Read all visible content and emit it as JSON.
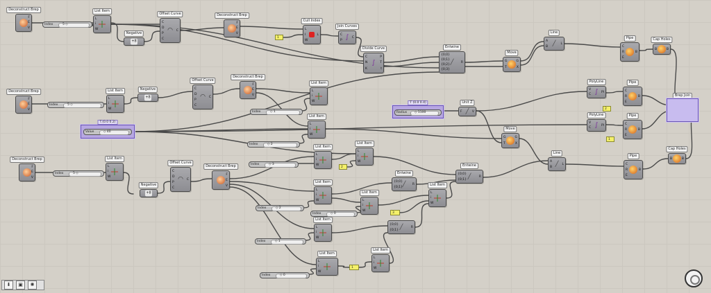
{
  "nodes": [
    {
      "id": "db1",
      "label": "Deconstruct Brep",
      "ins": [
        ""
      ],
      "outs": [
        "F",
        "E",
        "V"
      ],
      "icon": "brep"
    },
    {
      "id": "li1",
      "label": "List Item",
      "ins": [
        "L",
        "i",
        "W"
      ],
      "outs": [],
      "icon": "item"
    },
    {
      "id": "neg1",
      "label": "Negative",
      "ins": [],
      "outs": [],
      "icon": "neg"
    },
    {
      "id": "oc1",
      "label": "Offset Curve",
      "ins": [
        "C",
        "D",
        "P",
        "C"
      ],
      "outs": [
        "C"
      ],
      "icon": "offset"
    },
    {
      "id": "db2",
      "label": "Deconstruct Brep",
      "ins": [
        ""
      ],
      "outs": [
        "F",
        "E",
        "V"
      ],
      "icon": "brep"
    },
    {
      "id": "ci",
      "label": "Cull Index",
      "ins": [
        "L",
        "I",
        "W"
      ],
      "outs": [
        "L"
      ],
      "icon": "cull"
    },
    {
      "id": "jc",
      "label": "Join Curves",
      "ins": [
        "C",
        "P"
      ],
      "outs": [
        "C"
      ],
      "icon": "curve"
    },
    {
      "id": "dc",
      "label": "Divide Curve",
      "ins": [
        "C",
        "N",
        "K"
      ],
      "outs": [
        "P",
        "T",
        "t"
      ],
      "icon": "curve"
    },
    {
      "id": "ent1",
      "label": "Entwine",
      "ins": [
        "{0;0}",
        "{0;1}",
        "{0;2}",
        "{0;3}"
      ],
      "outs": [
        "R"
      ],
      "icon": "line"
    },
    {
      "id": "mv1",
      "label": "Move",
      "ins": [
        "G",
        "T"
      ],
      "outs": [
        "G",
        "X"
      ],
      "icon": "move"
    },
    {
      "id": "ln1",
      "label": "Line",
      "ins": [
        "A",
        "B"
      ],
      "outs": [
        "L"
      ],
      "icon": "line"
    },
    {
      "id": "pp1",
      "label": "Pipe",
      "ins": [
        "C",
        "R",
        "E"
      ],
      "outs": [
        "B"
      ],
      "icon": "pipe"
    },
    {
      "id": "ch1",
      "label": "Cap Holes",
      "ins": [
        "B"
      ],
      "outs": [
        "B"
      ],
      "icon": "pipe"
    },
    {
      "id": "db3",
      "label": "Deconstruct Brep",
      "ins": [
        ""
      ],
      "outs": [
        "F",
        "E",
        "V"
      ],
      "icon": "brep"
    },
    {
      "id": "li2",
      "label": "List Item",
      "ins": [
        "L",
        "i",
        "W"
      ],
      "outs": [],
      "icon": "item"
    },
    {
      "id": "neg2",
      "label": "Negative",
      "ins": [],
      "outs": [],
      "icon": "neg"
    },
    {
      "id": "oc2",
      "label": "Offset Curve",
      "ins": [
        "C",
        "D",
        "P",
        "C"
      ],
      "outs": [
        "C"
      ],
      "icon": "offset"
    },
    {
      "id": "db4",
      "label": "Deconstruct Brep",
      "ins": [
        ""
      ],
      "outs": [
        "F",
        "E",
        "V"
      ],
      "icon": "brep"
    },
    {
      "id": "li3",
      "label": "List Item",
      "ins": [
        "L",
        "i",
        "W"
      ],
      "outs": [],
      "icon": "item"
    },
    {
      "id": "li4",
      "label": "List Item",
      "ins": [
        "L",
        "i",
        "W"
      ],
      "outs": [],
      "icon": "item"
    },
    {
      "id": "pl1",
      "label": "PolyLine",
      "ins": [
        "V",
        "C"
      ],
      "outs": [
        "Pl"
      ],
      "icon": "curve"
    },
    {
      "id": "pp2",
      "label": "Pipe",
      "ins": [
        "C",
        "R",
        "E"
      ],
      "outs": [
        "B"
      ],
      "icon": "pipe"
    },
    {
      "id": "unz",
      "label": "Unit Z",
      "ins": [
        "F"
      ],
      "outs": [
        "V"
      ],
      "icon": "line"
    },
    {
      "id": "bj",
      "label": "Brep Join",
      "ins": [
        "B"
      ],
      "outs": [
        "B",
        "C"
      ],
      "icon": "brep"
    },
    {
      "id": "pl2",
      "label": "PolyLine",
      "ins": [
        "V",
        "C"
      ],
      "outs": [
        "Pl"
      ],
      "icon": "curve"
    },
    {
      "id": "pp3",
      "label": "Pipe",
      "ins": [
        "C",
        "R",
        "E"
      ],
      "outs": [
        "B"
      ],
      "icon": "pipe"
    },
    {
      "id": "mv2",
      "label": "Move",
      "ins": [
        "G",
        "T"
      ],
      "outs": [
        "G",
        "X"
      ],
      "icon": "move"
    },
    {
      "id": "db5",
      "label": "Deconstruct Brep",
      "ins": [
        ""
      ],
      "outs": [
        "F",
        "E",
        "V"
      ],
      "icon": "brep"
    },
    {
      "id": "li5",
      "label": "List Item",
      "ins": [
        "L",
        "i",
        "W"
      ],
      "outs": [],
      "icon": "item"
    },
    {
      "id": "oc3",
      "label": "Offset Curve",
      "ins": [
        "C",
        "D",
        "P",
        "C"
      ],
      "outs": [
        "C"
      ],
      "icon": "offset"
    },
    {
      "id": "db6",
      "label": "Deconstruct Brep",
      "ins": [
        ""
      ],
      "outs": [
        "F",
        "E",
        "V"
      ],
      "icon": "brep"
    },
    {
      "id": "neg3",
      "label": "Negative",
      "ins": [],
      "outs": [],
      "icon": "neg"
    },
    {
      "id": "li6",
      "label": "List Item",
      "ins": [
        "L",
        "i",
        "W"
      ],
      "outs": [],
      "icon": "item"
    },
    {
      "id": "li7",
      "label": "List Item",
      "ins": [
        "L",
        "i",
        "W"
      ],
      "outs": [],
      "icon": "item"
    },
    {
      "id": "ln2",
      "label": "Line",
      "ins": [
        "A",
        "B"
      ],
      "outs": [
        "L"
      ],
      "icon": "line"
    },
    {
      "id": "pp4",
      "label": "Pipe",
      "ins": [
        "C",
        "R",
        "E"
      ],
      "outs": [
        "B"
      ],
      "icon": "pipe"
    },
    {
      "id": "ch2",
      "label": "Cap Holes",
      "ins": [
        "B"
      ],
      "outs": [
        "B"
      ],
      "icon": "pipe"
    },
    {
      "id": "ent2",
      "label": "Entwine",
      "ins": [
        "{0;0}",
        "{0;1}"
      ],
      "outs": [
        "R"
      ],
      "icon": "line"
    },
    {
      "id": "ent3",
      "label": "Entwine",
      "ins": [
        "{0;0}",
        "{0;1}"
      ],
      "outs": [
        "R"
      ],
      "icon": "line"
    },
    {
      "id": "li8",
      "label": "List Item",
      "ins": [
        "L",
        "i",
        "W"
      ],
      "outs": [],
      "icon": "item"
    },
    {
      "id": "li9",
      "label": "List Item",
      "ins": [
        "L",
        "i",
        "W"
      ],
      "outs": [],
      "icon": "item"
    },
    {
      "id": "li10",
      "label": "List Item",
      "ins": [
        "L",
        "i",
        "W"
      ],
      "outs": [],
      "icon": "item"
    },
    {
      "id": "li11",
      "label": "List Item",
      "ins": [
        "L",
        "i",
        "W"
      ],
      "outs": [],
      "icon": "item"
    },
    {
      "id": "ln3",
      "label": "Line",
      "ins": [
        "A",
        "B"
      ],
      "outs": [
        "L"
      ],
      "icon": "line"
    },
    {
      "id": "ent4",
      "label": "",
      "ins": [
        "{0;0}",
        "{0;1}"
      ],
      "outs": [
        "R"
      ],
      "icon": "line"
    },
    {
      "id": "li12",
      "label": "List Item",
      "ins": [
        "L",
        "i",
        "W"
      ],
      "outs": [],
      "icon": "item"
    },
    {
      "id": "li13",
      "label": "List Item",
      "ins": [
        "L",
        "i",
        "W"
      ],
      "outs": [],
      "icon": "item"
    }
  ],
  "sliders": [
    {
      "id": "s1",
      "label": "Index",
      "value": "5 ◇"
    },
    {
      "id": "s2",
      "label": "Index",
      "value": "5 ◇"
    },
    {
      "id": "s3",
      "label": "Index",
      "value": "◇ 1"
    },
    {
      "id": "s4",
      "label": "Value",
      "value": "◇ 40",
      "title": "T.(0.0 0.2)"
    },
    {
      "id": "s5",
      "label": "Index",
      "value": "◇ 2"
    },
    {
      "id": "s6",
      "label": "Radius",
      "value": "◇ 1100",
      "title": "T (0.0 0.4)"
    },
    {
      "id": "s7",
      "label": "Index",
      "value": "5 ◇"
    },
    {
      "id": "s8",
      "label": "Index",
      "value": "◇ 3"
    },
    {
      "id": "s9",
      "label": "Index",
      "value": "◇ 2"
    },
    {
      "id": "s10",
      "label": "Index",
      "value": "◇ 0"
    },
    {
      "id": "s11",
      "label": "Index",
      "value": "◇ 1"
    },
    {
      "id": "s12",
      "label": "Index",
      "value": "◇ 0"
    }
  ],
  "panels": [
    {
      "id": "p1",
      "value": "1"
    },
    {
      "id": "p2",
      "value": "2"
    },
    {
      "id": "p3",
      "value": "2"
    },
    {
      "id": "p4",
      "value": "1"
    },
    {
      "id": "p5",
      "value": "3"
    },
    {
      "id": "p6",
      "value": "1"
    }
  ],
  "neg_values": {
    "neg1": "+8",
    "neg2": "+8",
    "neg3": "+8"
  },
  "toolbar": {
    "icons": [
      "download-icon",
      "layers-icon",
      "gear-icon"
    ]
  },
  "colors": {
    "wire": "#4a4a4a",
    "selection": "#b7a7e2",
    "panel": "#f4f06a"
  }
}
